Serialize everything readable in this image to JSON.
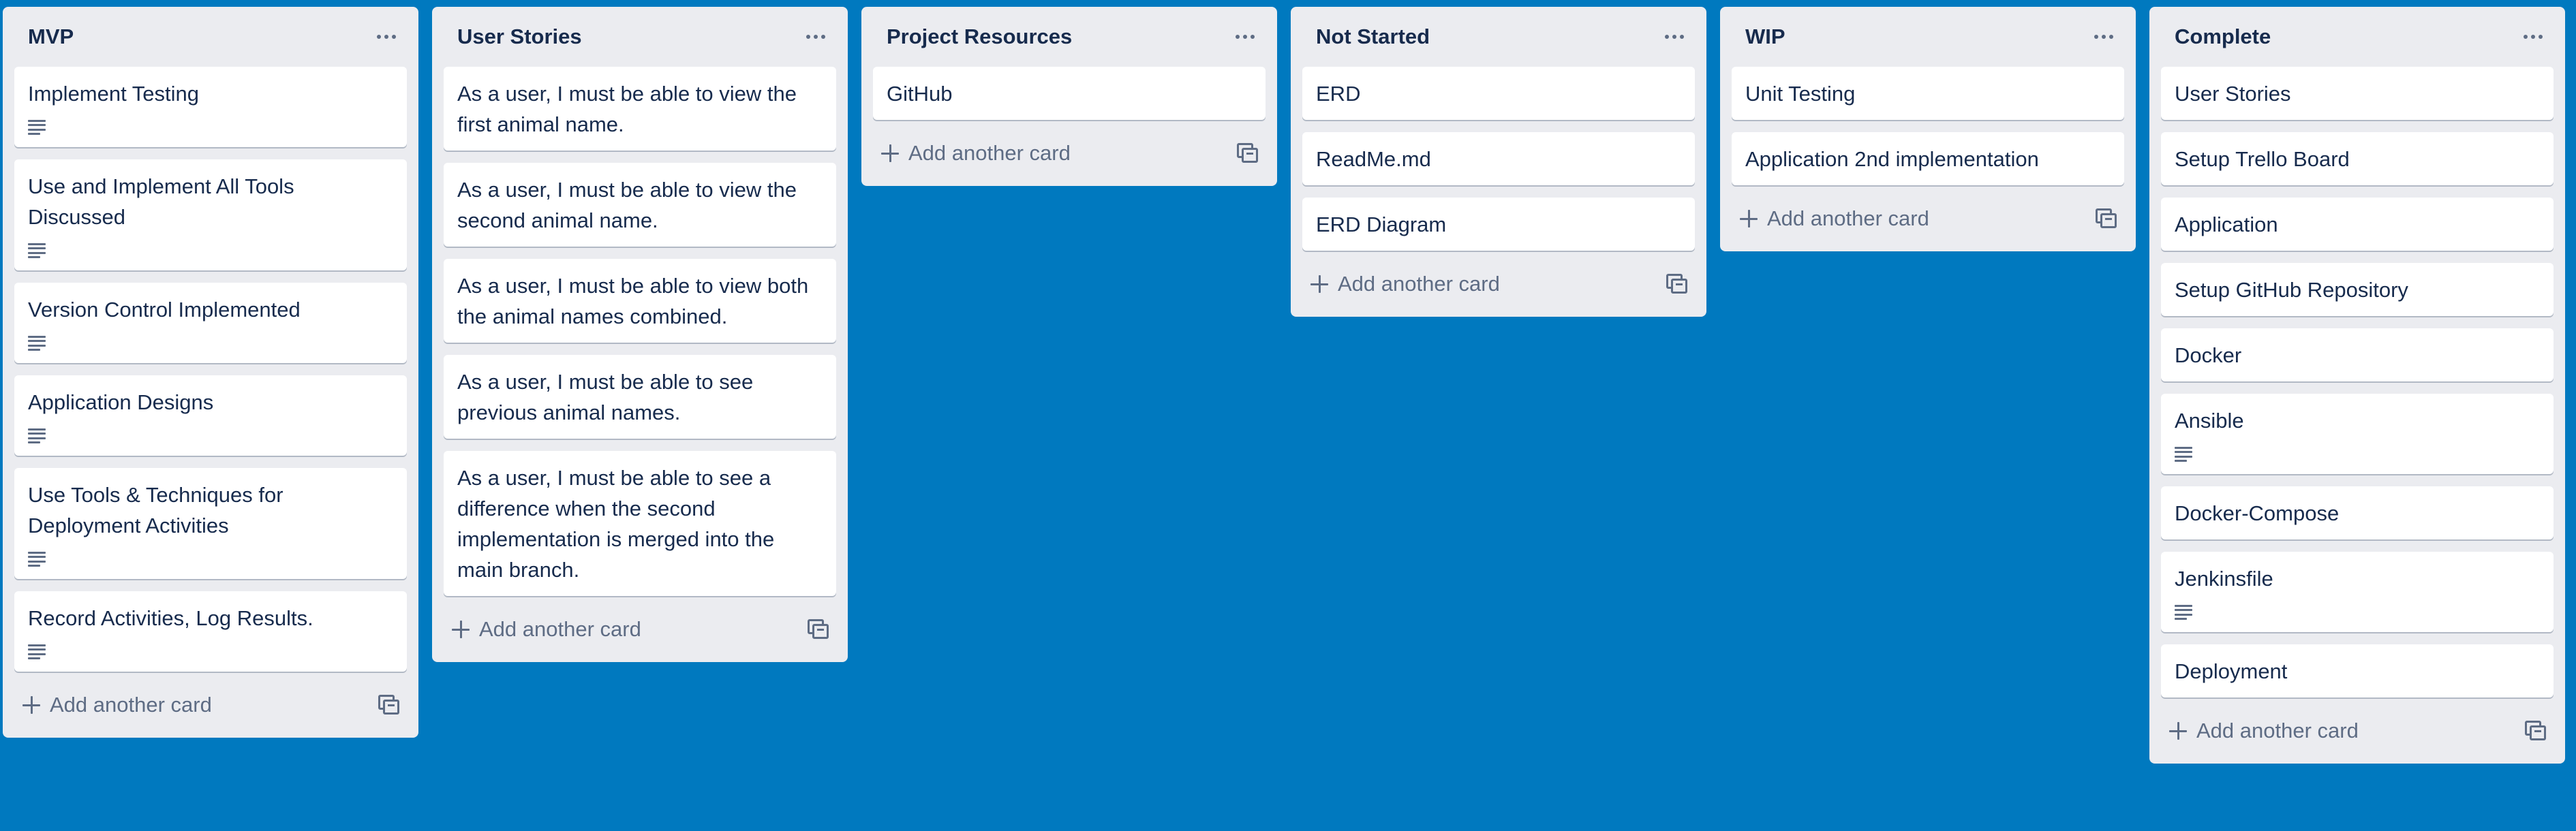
{
  "board": {
    "background_color": "#0079bf",
    "list_color": "#ebecf0",
    "add_card_label": "Add another card",
    "icons": {
      "list_menu": "ellipsis-icon",
      "description": "description-icon",
      "add": "plus-icon",
      "template": "card-template-icon"
    },
    "lists": [
      {
        "title": "MVP",
        "cards": [
          {
            "title": "Implement Testing",
            "has_description": true
          },
          {
            "title": "Use and Implement All Tools Discussed",
            "has_description": true
          },
          {
            "title": "Version Control Implemented",
            "has_description": true
          },
          {
            "title": "Application Designs",
            "has_description": true
          },
          {
            "title": "Use Tools & Techniques for Deployment Activities",
            "has_description": true
          },
          {
            "title": "Record Activities, Log Results.",
            "has_description": true
          }
        ]
      },
      {
        "title": "User Stories",
        "cards": [
          {
            "title": "As a user, I must be able to view the first animal name.",
            "has_description": false
          },
          {
            "title": "As a user, I must be able to view the second animal name.",
            "has_description": false
          },
          {
            "title": "As a user, I must be able to view both the animal names combined.",
            "has_description": false
          },
          {
            "title": "As a user, I must be able to see previous animal names.",
            "has_description": false
          },
          {
            "title": "As a user, I must be able to see a difference when the second implementation is merged into the main branch.",
            "has_description": false
          }
        ]
      },
      {
        "title": "Project Resources",
        "cards": [
          {
            "title": "GitHub",
            "has_description": false
          }
        ]
      },
      {
        "title": "Not Started",
        "cards": [
          {
            "title": "ERD",
            "has_description": false
          },
          {
            "title": "ReadMe.md",
            "has_description": false
          },
          {
            "title": "ERD Diagram",
            "has_description": false
          }
        ]
      },
      {
        "title": "WIP",
        "cards": [
          {
            "title": "Unit Testing",
            "has_description": false
          },
          {
            "title": "Application 2nd implementation",
            "has_description": false
          }
        ]
      },
      {
        "title": "Complete",
        "cards": [
          {
            "title": "User Stories",
            "has_description": false
          },
          {
            "title": "Setup Trello Board",
            "has_description": false
          },
          {
            "title": "Application",
            "has_description": false
          },
          {
            "title": "Setup GitHub Repository",
            "has_description": false
          },
          {
            "title": "Docker",
            "has_description": false
          },
          {
            "title": "Ansible",
            "has_description": true
          },
          {
            "title": "Docker-Compose",
            "has_description": false
          },
          {
            "title": "Jenkinsfile",
            "has_description": true
          },
          {
            "title": "Deployment",
            "has_description": false
          }
        ]
      }
    ]
  }
}
